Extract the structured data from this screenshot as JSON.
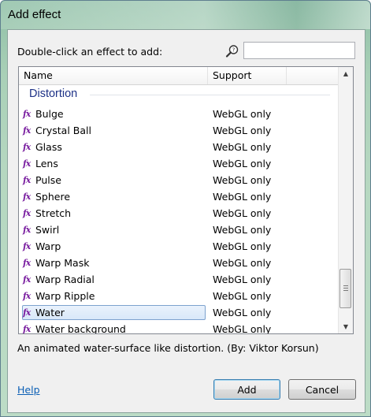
{
  "window": {
    "title": "Add effect"
  },
  "prompt": "Double-click an effect to add:",
  "search": {
    "value": "",
    "placeholder": ""
  },
  "columns": {
    "name": "Name",
    "support": "Support"
  },
  "group": "Distortion",
  "effect_icon_label": "fx",
  "effects": [
    {
      "name": "Bulge",
      "support": "WebGL only"
    },
    {
      "name": "Crystal Ball",
      "support": "WebGL only"
    },
    {
      "name": "Glass",
      "support": "WebGL only"
    },
    {
      "name": "Lens",
      "support": "WebGL only"
    },
    {
      "name": "Pulse",
      "support": "WebGL only"
    },
    {
      "name": "Sphere",
      "support": "WebGL only"
    },
    {
      "name": "Stretch",
      "support": "WebGL only"
    },
    {
      "name": "Swirl",
      "support": "WebGL only"
    },
    {
      "name": "Warp",
      "support": "WebGL only"
    },
    {
      "name": "Warp Mask",
      "support": "WebGL only"
    },
    {
      "name": "Warp Radial",
      "support": "WebGL only"
    },
    {
      "name": "Warp Ripple",
      "support": "WebGL only"
    },
    {
      "name": "Water",
      "support": "WebGL only",
      "selected": true
    },
    {
      "name": "Water background",
      "support": "WebGL only"
    }
  ],
  "description": "An animated water-surface like distortion. (By: Viktor Korsun)",
  "help_link": "Help",
  "buttons": {
    "add": "Add",
    "cancel": "Cancel"
  },
  "icons": {
    "search": "search-icon",
    "effect": "fx-icon"
  },
  "colors": {
    "group_heading": "#1e3287",
    "fx_icon": "#7a1fa0",
    "link": "#0b5fb5",
    "selection_border": "#7da2ce"
  }
}
